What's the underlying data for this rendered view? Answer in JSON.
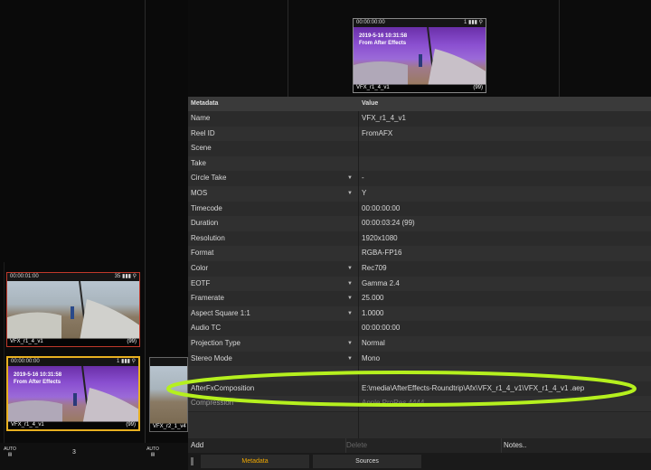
{
  "reel": {
    "clips": [
      {
        "timecode": "00:00:01:00",
        "number": "35",
        "name": "VFX_r1_4_v1",
        "count": "(99)"
      },
      {
        "timecode": "00:00:00:00",
        "number": "1",
        "name": "VFX_r1_4_v1",
        "count": "(99)",
        "overlay_line1": "2019-5-16 10:31:58",
        "overlay_line2": "From After Effects"
      },
      {
        "name": "VFX_r2_1_v4"
      }
    ],
    "footer": {
      "auto_label_1": "AUTO",
      "page_number": "3",
      "auto_label_2": "AUTO"
    }
  },
  "preview": {
    "timecode": "00:00:00:00",
    "number": "1",
    "overlay_line1": "2019-5-16 10:31:58",
    "overlay_line2": "From After Effects",
    "name": "VFX_r1_4_v1",
    "count": "(99)"
  },
  "metadata": {
    "header": {
      "col1": "Metadata",
      "col2": "Value"
    },
    "rows": [
      {
        "name": "Name",
        "value": "VFX_r1_4_v1",
        "dropdown": false
      },
      {
        "name": "Reel ID",
        "value": "FromAFX",
        "dropdown": false
      },
      {
        "name": "Scene",
        "value": "",
        "dropdown": false
      },
      {
        "name": "Take",
        "value": "",
        "dropdown": false
      },
      {
        "name": "Circle Take",
        "value": "-",
        "dropdown": true
      },
      {
        "name": "MOS",
        "value": "Y",
        "dropdown": true
      },
      {
        "name": "Timecode",
        "value": "00:00:00:00",
        "dropdown": false
      },
      {
        "name": "Duration",
        "value": "00:00:03:24 (99)",
        "dropdown": false
      },
      {
        "name": "Resolution",
        "value": "1920x1080",
        "dropdown": false
      },
      {
        "name": "Format",
        "value": " RGBA-FP16",
        "dropdown": false
      },
      {
        "name": "Color",
        "value": "Rec709",
        "dropdown": true
      },
      {
        "name": "EOTF",
        "value": "Gamma 2.4",
        "dropdown": true
      },
      {
        "name": "Framerate",
        "value": "25.000",
        "dropdown": true
      },
      {
        "name": "Aspect Square 1:1",
        "value": "1.0000",
        "dropdown": true
      },
      {
        "name": "Audio TC",
        "value": "00:00:00:00",
        "dropdown": false
      },
      {
        "name": "Projection Type",
        "value": "Normal",
        "dropdown": true
      },
      {
        "name": "Stereo Mode",
        "value": "Mono",
        "dropdown": true
      },
      {
        "name": "",
        "value": "",
        "dropdown": false
      },
      {
        "name": "AfterFxComposition",
        "value": "E:\\media\\AfterEffects-Roundtrip\\Afx\\VFX_r1_4_v1\\VFX_r1_4_v1 .aep",
        "dropdown": false
      },
      {
        "name": "Compression",
        "value": "Apple ProRes 4444",
        "dropdown": false
      }
    ]
  },
  "actions": {
    "add": "Add",
    "delete": "Delete",
    "notes": "Notes.."
  },
  "tabs": {
    "metadata": "Metadata",
    "sources": "Sources"
  },
  "colors": {
    "highlight_ellipse": "#b5f01e",
    "selected_border": "#e8b020",
    "red_border": "#c0392b",
    "tab_active_text": "#f0a800"
  }
}
